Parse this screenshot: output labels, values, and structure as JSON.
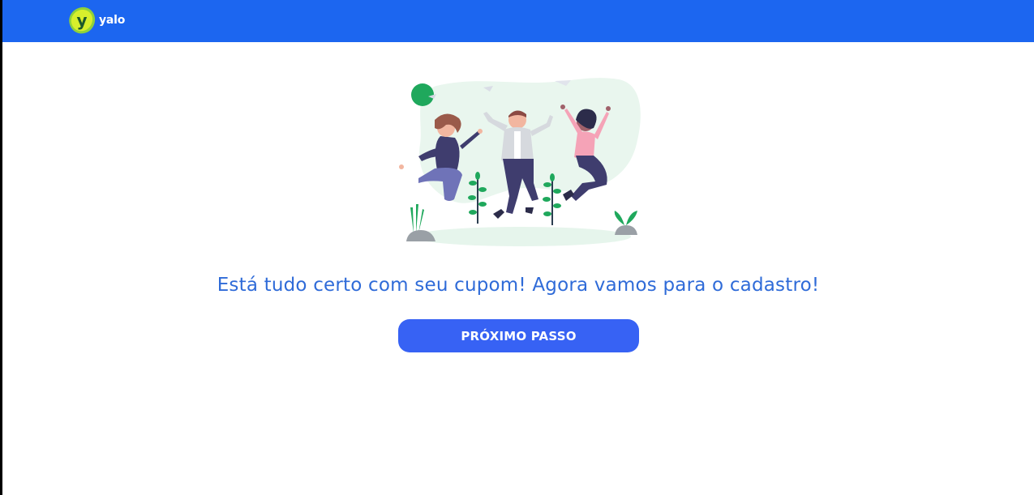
{
  "header": {
    "logo_text": "yalo",
    "logo_mark_letter": "y",
    "bar_color": "#1c66f0"
  },
  "hero": {
    "illustration": "three-people-jumping-celebration",
    "icons": [
      "celebration-illustration",
      "logo-mark-icon"
    ]
  },
  "main": {
    "message": "Está tudo certo com seu cupom! Agora vamos para o cadastro!",
    "message_color": "#2f6bd8"
  },
  "actions": {
    "next_label": "PRÓXIMO PASSO",
    "next_color": "#3762f4"
  }
}
